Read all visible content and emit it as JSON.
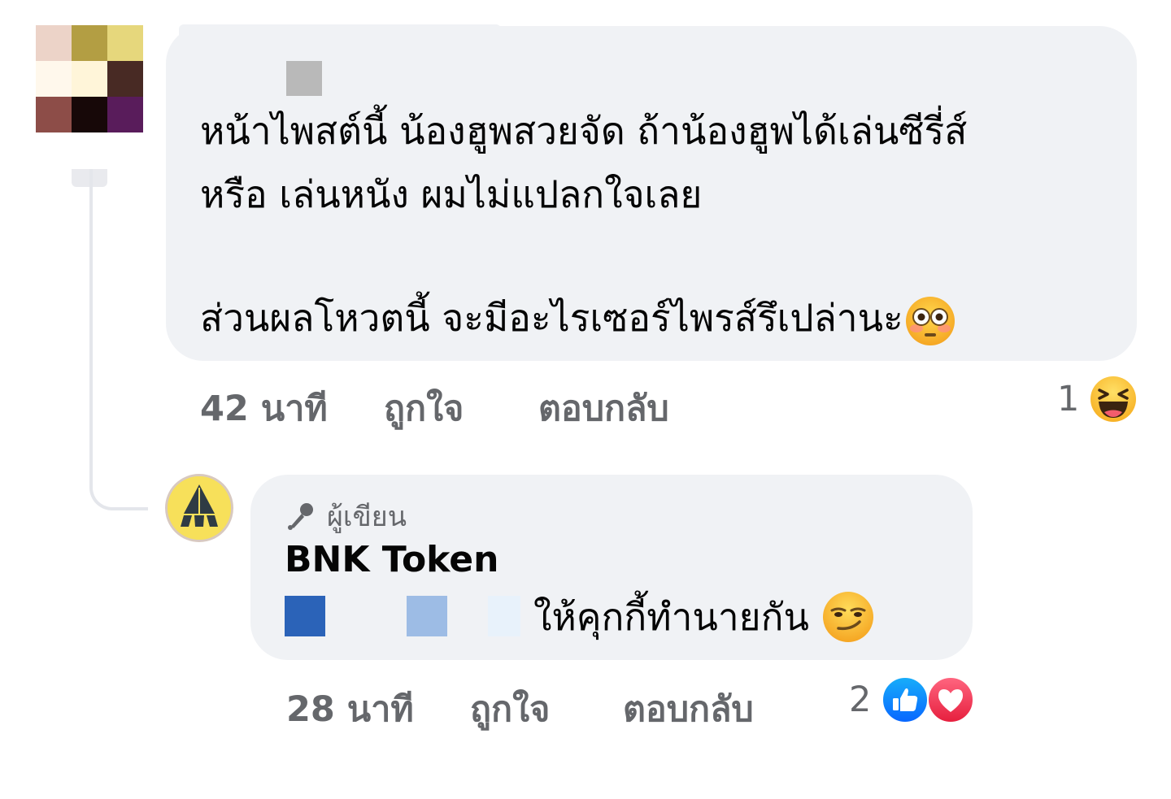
{
  "colors": {
    "bubble_bg": "#f0f2f5",
    "meta_text": "#65676b",
    "primary_text": "#050505",
    "like_blue": "#1877f2",
    "love_red": "#f33e58"
  },
  "comment": {
    "avatar_pixels": [
      "#ecd3c8",
      "#b39e43",
      "#e6d77c",
      "#fff8ec",
      "#fff5d9",
      "#482a24",
      "#8d4d48",
      "#170808",
      "#591c5b"
    ],
    "text_lines": "หน้าไพสต์นี้ น้องฮูพสวยจัด ถ้าน้องฮูพได้เล่นซีรี่ส์\nหรือ เล่นหนัง ผมไม่แปลกใจเลย",
    "text_line3": "ส่วนผลโหวตนี้ จะมีอะไรเซอร์ไพรส์รึเปล่านะ",
    "text_emoji": "flushed-face-icon",
    "time": "42 นาที",
    "like_label": "ถูกใจ",
    "reply_label": "ตอบกลับ",
    "reaction_count": "1",
    "reaction_icon": "haha-reaction-icon"
  },
  "reply": {
    "author_badge_icon": "microphone-icon",
    "author_badge": "ผู้เขียน",
    "author_name": "BNK Token",
    "text": "ให้คุกกี้ทำนายกัน",
    "text_emoji": "smirking-face-icon",
    "time": "28 นาที",
    "like_label": "ถูกใจ",
    "reply_label": "ตอบกลับ",
    "reaction_count": "2",
    "reaction_icons": [
      "like-reaction-icon",
      "love-reaction-icon"
    ]
  }
}
